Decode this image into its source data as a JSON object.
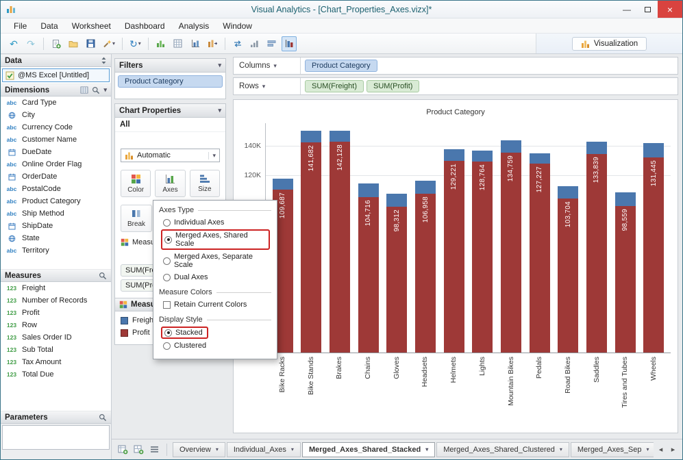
{
  "window": {
    "title": "Visual Analytics - [Chart_Properties_Axes.vizx]*"
  },
  "menu": [
    "File",
    "Data",
    "Worksheet",
    "Dashboard",
    "Analysis",
    "Window"
  ],
  "toolbar": {
    "visualization_label": "Visualization",
    "icons": [
      {
        "name": "undo",
        "glyph": "↶",
        "color": "#2e9ac4"
      },
      {
        "name": "redo",
        "glyph": "↷",
        "color": "#8fc6da"
      },
      {
        "name": "separator"
      },
      {
        "name": "new-worksheet",
        "icon": "page-plus"
      },
      {
        "name": "open-workbook",
        "icon": "folder"
      },
      {
        "name": "save",
        "icon": "floppy"
      },
      {
        "name": "auto-chart-wand",
        "icon": "wand",
        "dropdown": true
      },
      {
        "name": "separator"
      },
      {
        "name": "refresh-data",
        "glyph": "↻",
        "color": "#2e7fc1",
        "dropdown": true
      },
      {
        "name": "separator"
      },
      {
        "name": "add-chart",
        "icon": "bars-plus"
      },
      {
        "name": "add-crosstab",
        "icon": "grid-plus"
      },
      {
        "name": "chart-type",
        "icon": "bars-axis"
      },
      {
        "name": "chart-data",
        "icon": "bars-arrow"
      },
      {
        "name": "separator"
      },
      {
        "name": "swap-axes",
        "icon": "swap"
      },
      {
        "name": "sort-ascending",
        "icon": "sort-asc"
      },
      {
        "name": "fit-rows",
        "icon": "rows"
      },
      {
        "name": "merged-axes-toggle",
        "icon": "merged-axes",
        "selected": true
      }
    ]
  },
  "data_panel": {
    "title": "Data",
    "source": "@MS Excel [Untitled]",
    "dimensions": {
      "title": "Dimensions",
      "items": [
        {
          "icon": "abc",
          "label": "Card Type"
        },
        {
          "icon": "globe",
          "label": "City"
        },
        {
          "icon": "abc",
          "label": "Currency Code"
        },
        {
          "icon": "abc",
          "label": "Customer Name"
        },
        {
          "icon": "calendar",
          "label": "DueDate"
        },
        {
          "icon": "abc",
          "label": "Online Order Flag"
        },
        {
          "icon": "calendar",
          "label": "OrderDate"
        },
        {
          "icon": "abc",
          "label": "PostalCode"
        },
        {
          "icon": "abc",
          "label": "Product Category"
        },
        {
          "icon": "abc",
          "label": "Ship Method"
        },
        {
          "icon": "calendar",
          "label": "ShipDate"
        },
        {
          "icon": "globe",
          "label": "State"
        },
        {
          "icon": "abc",
          "label": "Territory"
        }
      ]
    },
    "measures": {
      "title": "Measures",
      "items": [
        {
          "icon": "123",
          "label": "Freight"
        },
        {
          "icon": "123",
          "label": "Number of Records"
        },
        {
          "icon": "123",
          "label": "Profit"
        },
        {
          "icon": "123",
          "label": "Row"
        },
        {
          "icon": "123",
          "label": "Sales Order ID"
        },
        {
          "icon": "123",
          "label": "Sub Total"
        },
        {
          "icon": "123",
          "label": "Tax Amount"
        },
        {
          "icon": "123",
          "label": "Total Due"
        }
      ]
    },
    "parameters": {
      "title": "Parameters"
    }
  },
  "filters_panel": {
    "title": "Filters",
    "pills": [
      "Product Category"
    ]
  },
  "chart_properties": {
    "title": "Chart Properties",
    "scope": "All",
    "style_value": "Automatic",
    "buttons": [
      "Color",
      "Axes",
      "Size"
    ],
    "break_button": "Break",
    "measures_shelf_label": "Measures",
    "measure_pills": [
      "SUM(Freight)",
      "SUM(Profit)"
    ],
    "legend_title": "Measure Colors",
    "legend": [
      {
        "label": "Freight",
        "color": "#4a77ad"
      },
      {
        "label": "Profit",
        "color": "#9e3937"
      }
    ]
  },
  "axes_popup": {
    "annotation_color": "#cc2222",
    "groups": [
      {
        "title": "Axes Type",
        "options": [
          {
            "type": "radio",
            "label": "Individual Axes",
            "checked": false
          },
          {
            "type": "radio",
            "label": "Merged Axes, Shared Scale",
            "checked": true,
            "annotated": true
          },
          {
            "type": "radio",
            "label": "Merged Axes, Separate Scale",
            "checked": false
          },
          {
            "type": "radio",
            "label": "Dual Axes",
            "checked": false
          }
        ]
      },
      {
        "title": "Measure Colors",
        "options": [
          {
            "type": "checkbox",
            "label": "Retain Current Colors",
            "checked": false
          }
        ]
      },
      {
        "title": "Display Style",
        "options": [
          {
            "type": "radio",
            "label": "Stacked",
            "checked": true,
            "annotated": true
          },
          {
            "type": "radio",
            "label": "Clustered",
            "checked": false
          }
        ]
      }
    ]
  },
  "shelves": {
    "columns": {
      "label": "Columns",
      "pills": [
        {
          "label": "Product Category",
          "kind": "dimension"
        }
      ]
    },
    "rows": {
      "label": "Rows",
      "pills": [
        {
          "label": "SUM(Freight)",
          "kind": "measure"
        },
        {
          "label": "SUM(Profit)",
          "kind": "measure"
        }
      ]
    }
  },
  "chart_data": {
    "type": "bar",
    "stacked": true,
    "title": "Product Category",
    "categories": [
      "Bike Racks",
      "Bike Stands",
      "Brakes",
      "Chains",
      "Gloves",
      "Headsets",
      "Helmets",
      "Lights",
      "Mountain Bikes",
      "Pedals",
      "Road Bikes",
      "Saddles",
      "Tires and Tubes",
      "Wheels"
    ],
    "series": [
      {
        "name": "Freight",
        "color": "#4a77ad",
        "values": [
          7500,
          7600,
          7200,
          9200,
          8500,
          9000,
          7800,
          7300,
          8300,
          6900,
          8200,
          8100,
          9300,
          9500
        ]
      },
      {
        "name": "Profit",
        "color": "#9e3937",
        "values": [
          109687,
          141682,
          142128,
          104716,
          98312,
          106958,
          129221,
          128764,
          134759,
          127227,
          103704,
          133839,
          98559,
          131445
        ]
      }
    ],
    "bar_labels": [
      "109,687",
      "141,682",
      "142,128",
      "104,716",
      "98,312",
      "106,958",
      "129,221",
      "128,764",
      "134,759",
      "127,227",
      "103,704",
      "133,839",
      "98,559",
      "131,445"
    ],
    "y_ticks": [
      {
        "label": "140K",
        "value": 140000
      },
      {
        "label": "120K",
        "value": 120000
      }
    ],
    "ylim": [
      0,
      155000
    ],
    "grid": true,
    "legend_position": "left-panel"
  },
  "sheet_tabs": [
    {
      "label": "Overview",
      "active": false
    },
    {
      "label": "Individual_Axes",
      "active": false
    },
    {
      "label": "Merged_Axes_Shared_Stacked",
      "active": true
    },
    {
      "label": "Merged_Axes_Shared_Clustered",
      "active": false
    },
    {
      "label": "Merged_Axes_Sep",
      "active": false
    }
  ]
}
